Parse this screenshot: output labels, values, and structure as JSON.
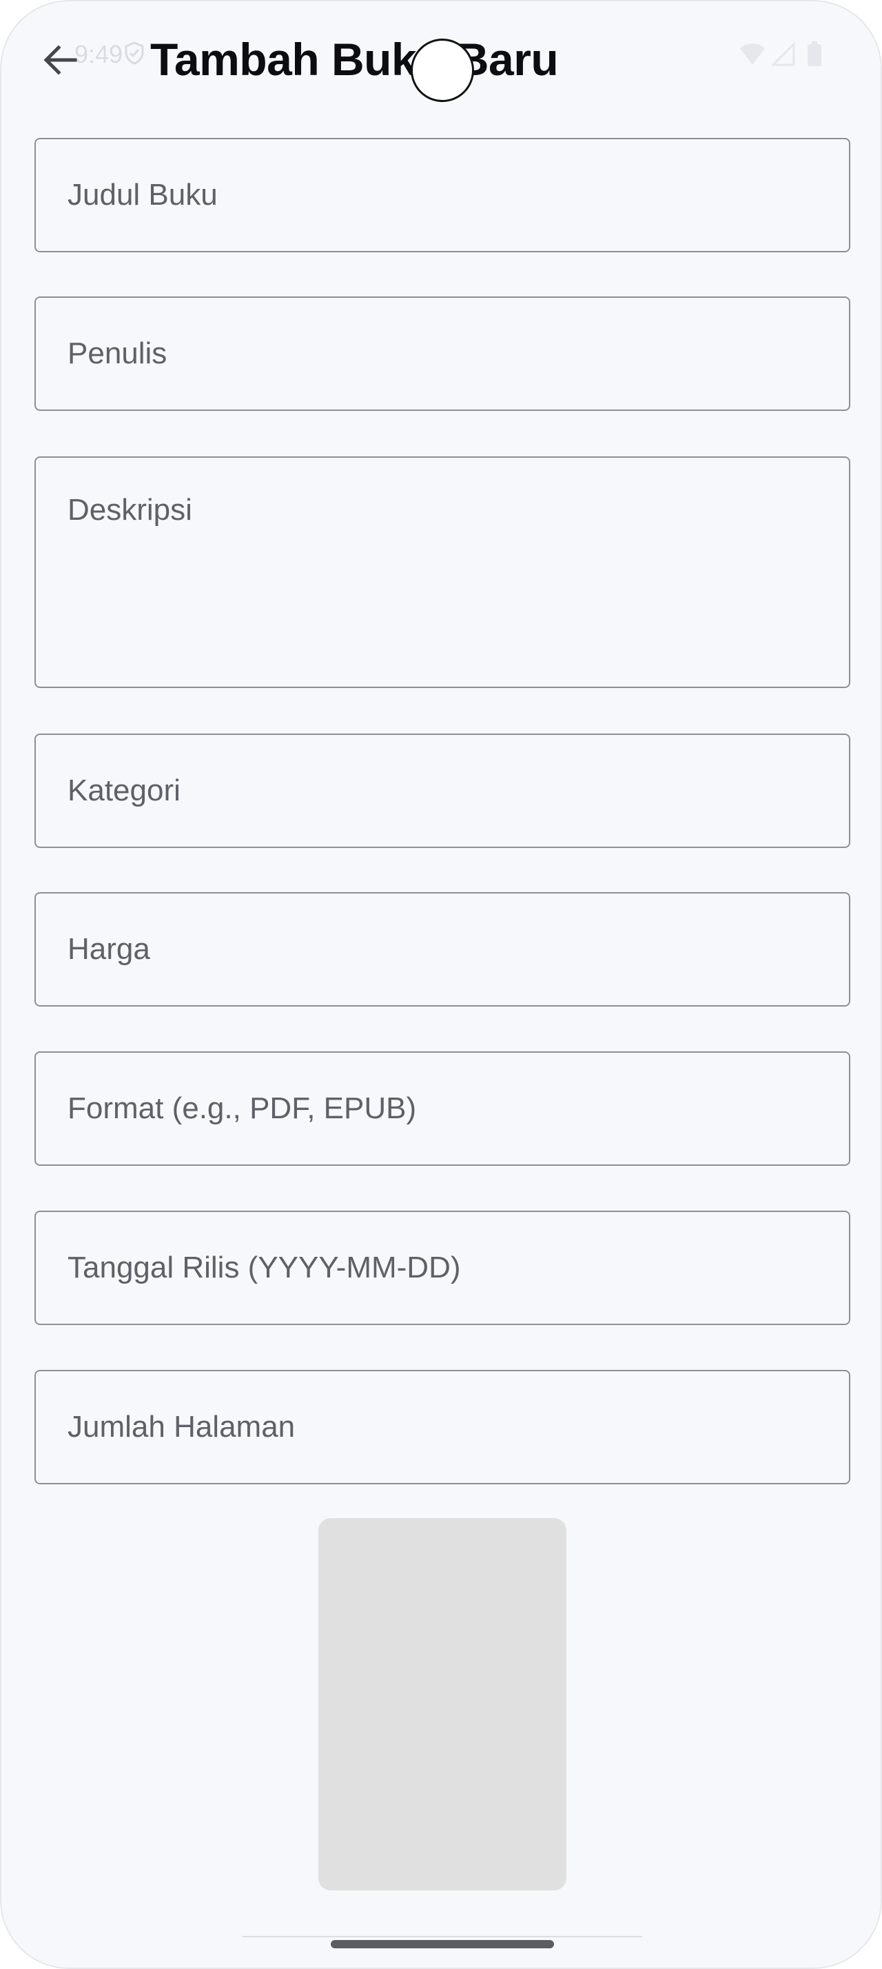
{
  "status_bar": {
    "time": "9:49",
    "icons": [
      "shield-icon",
      "wifi-icon",
      "signal-icon",
      "battery-icon"
    ]
  },
  "app_bar": {
    "title": "Tambah Buku Baru",
    "back_icon": "arrow-back-icon"
  },
  "form": {
    "fields": [
      {
        "name": "title",
        "placeholder": "Judul Buku",
        "value": ""
      },
      {
        "name": "author",
        "placeholder": "Penulis",
        "value": ""
      },
      {
        "name": "description",
        "placeholder": "Deskripsi",
        "value": ""
      },
      {
        "name": "category",
        "placeholder": "Kategori",
        "value": ""
      },
      {
        "name": "price",
        "placeholder": "Harga",
        "value": ""
      },
      {
        "name": "format",
        "placeholder": "Format (e.g., PDF, EPUB)",
        "value": ""
      },
      {
        "name": "release_date",
        "placeholder": "Tanggal Rilis (YYYY-MM-DD)",
        "value": ""
      },
      {
        "name": "page_count",
        "placeholder": "Jumlah Halaman",
        "value": ""
      }
    ]
  },
  "colors": {
    "background": "#f7f8fc",
    "field_border": "#8e8f95",
    "placeholder": "#5f6168",
    "image_placeholder": "#e0e0e0",
    "title": "#0d0d0f"
  }
}
